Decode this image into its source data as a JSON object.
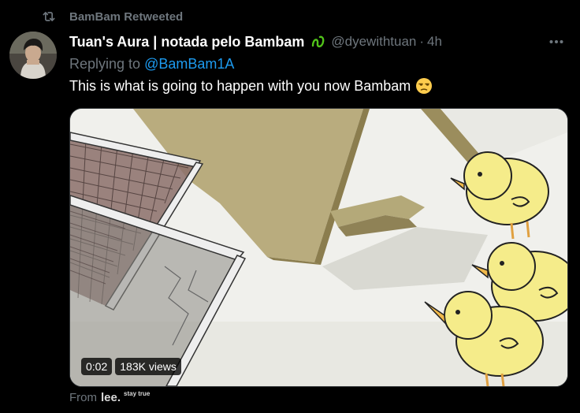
{
  "retweet": {
    "icon": "retweet-icon",
    "label": "BamBam Retweeted"
  },
  "author": {
    "display_name": "Tuan's Aura | notada pelo Bambam",
    "badge_icon": "sprout-icon",
    "handle": "@dyewithtuan",
    "separator": "·",
    "time": "4h"
  },
  "more_icon": "more-horizontal-icon",
  "reply": {
    "prefix": "Replying to",
    "mention": "@BamBam1A"
  },
  "text": "This is what is going to happen with you now Bambam",
  "emoji": "unamused-face-emoji",
  "media": {
    "type": "video",
    "duration": "0:02",
    "views": "183K views"
  },
  "source": {
    "prefix": "From",
    "app": "lee.",
    "tag": "stay true"
  },
  "colors": {
    "background": "#000000",
    "secondary_text": "#6e767d",
    "link": "#1d9bf0",
    "primary_text": "#ffffff",
    "badge": "#52c41a"
  }
}
